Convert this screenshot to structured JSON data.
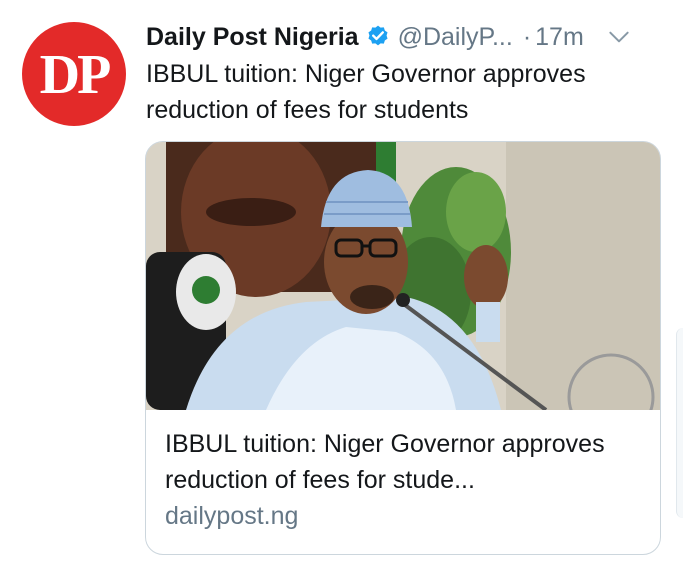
{
  "tweet": {
    "avatar": {
      "text": "DP",
      "color": "#e32a29"
    },
    "author": {
      "name": "Daily Post Nigeria",
      "verified": true,
      "handle": "@DailyP...",
      "separator": "·",
      "time": "17m"
    },
    "text": "IBBUL tuition: Niger Governor approves reduction of fees for students",
    "card": {
      "title": "IBBUL tuition: Niger Governor approves reduction of fees for stude...",
      "domain": "dailypost.ng"
    }
  },
  "colors": {
    "text_primary": "#14171a",
    "text_secondary": "#657786",
    "verified_blue": "#1da1f2",
    "border": "#ccd6dd"
  },
  "icons": [
    "verified-badge-icon",
    "chevron-down-icon"
  ]
}
